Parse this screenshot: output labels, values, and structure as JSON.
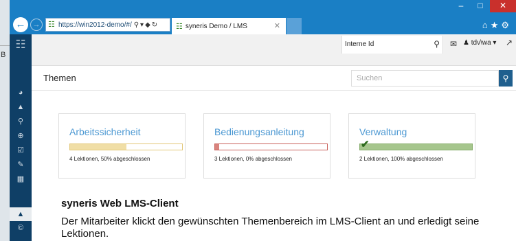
{
  "desktop": {
    "letter": "B"
  },
  "browser": {
    "url": "https://win2012-demo/#/",
    "tab_title": "syneris Demo / LMS",
    "window_controls": [
      "minimize-icon",
      "maximize-icon",
      "close-icon"
    ]
  },
  "app": {
    "topbar": {
      "id_field_value": "Interne Id",
      "user": "tdv\\wa"
    },
    "sidebar_icons": [
      "dashboard-icon",
      "sitemap-icon",
      "search-icon",
      "zoom-icon",
      "checklist-icon",
      "pencil-icon",
      "grid-icon",
      "graduation-cap-icon",
      "copyright-icon"
    ],
    "page_title": "Themen",
    "search_placeholder": "Suchen",
    "topics": [
      {
        "title": "Arbeitssicherheit",
        "progress": 0.5,
        "status": "4 Lektionen, 50% abgeschlossen",
        "color": "#f0dea6",
        "border": "#e2c777"
      },
      {
        "title": "Bedienungsanleitung",
        "progress": 0.0,
        "status": "3 Lektionen, 0% abgeschlossen",
        "color": "#d9847e",
        "border": "#c9615b"
      },
      {
        "title": "Verwaltung",
        "progress": 1.0,
        "status": "2 Lektionen, 100% abgeschlossen",
        "color": "#a6c68d",
        "border": "#86ad6b"
      }
    ]
  },
  "caption": {
    "title": "syneris Web LMS-Client",
    "body": "Der Mitarbeiter klickt den gewünschten Themenbereich im LMS-Client an und erledigt seine Lektionen."
  }
}
